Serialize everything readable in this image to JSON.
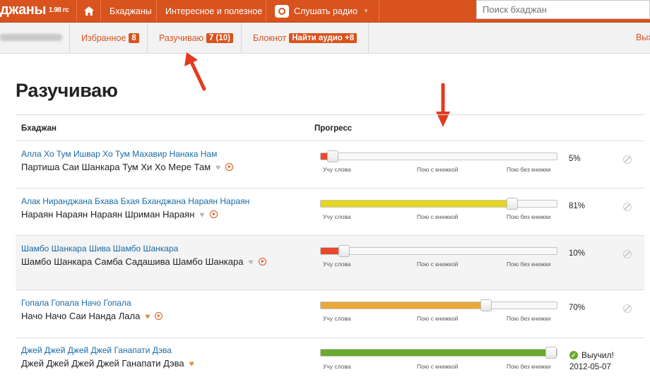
{
  "topbar": {
    "brand": "джаны",
    "version": "1.98 гс",
    "home_icon": "home-icon",
    "nav_bhajans": "Бхаджаны",
    "nav_interesting": "Интересное и полезное",
    "nav_radio": "Слушать радио",
    "search_placeholder": "Поиск бхаджан"
  },
  "subbar": {
    "favorites_label": "Избранное",
    "favorites_count": "8",
    "learning_label": "Разучиваю",
    "learning_count": "7 (10)",
    "notebook_label": "Блокнот",
    "find_audio": "Найти аудио +8",
    "exit_label": "Вых"
  },
  "colors": {
    "brand": "#d9531e",
    "link": "#1a6aa7",
    "progress_red": "#e9492c",
    "progress_yellow": "#e6d61e",
    "progress_orange": "#eba93a",
    "progress_green": "#6aaa2c"
  },
  "page": {
    "title": "Разучиваю",
    "col_bhajan": "Бхаджан",
    "col_progress": "Прогресс"
  },
  "progress_labels": {
    "learn_words": "Учу слова",
    "sing_with_book": "Пою с книжкой",
    "sing_without_book": "Пою без книжки"
  },
  "rows": [
    {
      "title": "Алла Хо Тум Ишвар Хо Тум Махавир Нанака Нам",
      "subtitle": "Партиша Саи Шанкара Тум Хи Хо Мере Там",
      "progress": 5,
      "pct_text": "5%",
      "color": "#e9492c",
      "favorite": false,
      "has_play": true,
      "learned": false
    },
    {
      "title": "Алак Ниранджана Бхава Бхая Бханджана Нараян Нараян",
      "subtitle": "Нараян Нараян Нараян Шриман Нараян",
      "progress": 81,
      "pct_text": "81%",
      "color": "#e6d61e",
      "favorite": false,
      "has_play": true,
      "learned": false
    },
    {
      "title": "Шамбо Шанкара Шива Шамбо Шанкара",
      "subtitle": "Шамбо Шанкара Самба Садашива Шамбо Шанкара",
      "progress": 10,
      "pct_text": "10%",
      "color": "#e9492c",
      "favorite": false,
      "has_play": true,
      "learned": false
    },
    {
      "title": "Гопала Гопала Начо Гопала",
      "subtitle": "Начо Начо Саи Нанда Лала",
      "progress": 70,
      "pct_text": "70%",
      "color": "#eba93a",
      "favorite": true,
      "has_play": true,
      "learned": false
    },
    {
      "title": "Джей Джей Джей Джей Ганапати Дэва",
      "subtitle": "Джей Джей Джей Джей Ганапати Дэва",
      "progress": 100,
      "pct_text": "",
      "color": "#6aaa2c",
      "favorite": true,
      "has_play": false,
      "learned": true,
      "learned_text": "Выучил!",
      "learned_date": "2012-05-07"
    }
  ]
}
